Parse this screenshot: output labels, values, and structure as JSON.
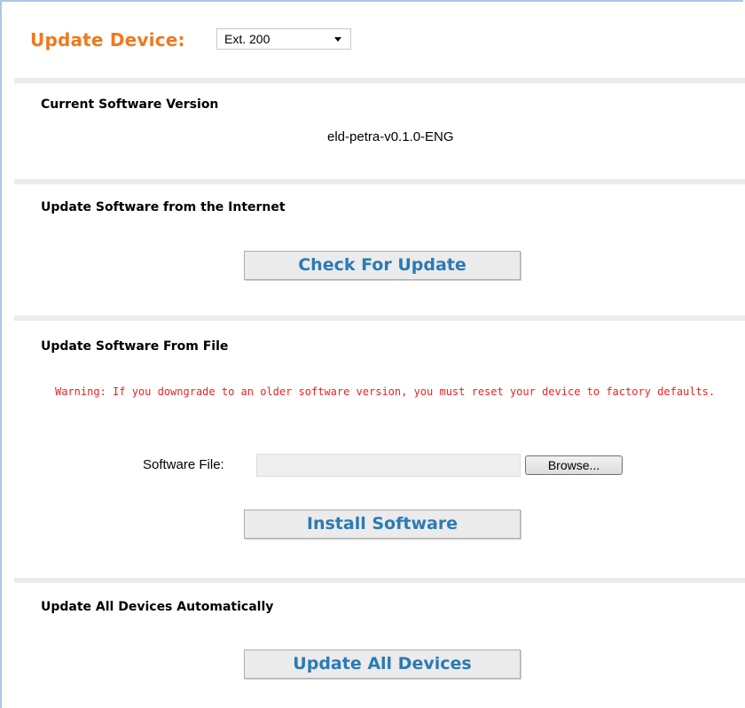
{
  "header": {
    "label": "Update Device:",
    "device_select": {
      "selected": "Ext. 200"
    }
  },
  "current_version": {
    "title": "Current Software Version",
    "value": "eld-petra-v0.1.0-ENG"
  },
  "internet_update": {
    "title": "Update Software from the Internet",
    "button_label": "Check For Update"
  },
  "file_update": {
    "title": "Update Software From File",
    "warning": "Warning: If you downgrade to an older software version, you must reset your device to factory defaults.",
    "file_label": "Software File:",
    "file_value": "",
    "browse_label": "Browse...",
    "button_label": "Install Software"
  },
  "auto_update": {
    "title": "Update All Devices Automatically",
    "button_label": "Update All Devices"
  },
  "colors": {
    "accent_orange": "#f0781e",
    "button_text_blue": "#2b7ab5",
    "warning_red": "#ee2222",
    "frame_blue": "#a9c8e6"
  }
}
